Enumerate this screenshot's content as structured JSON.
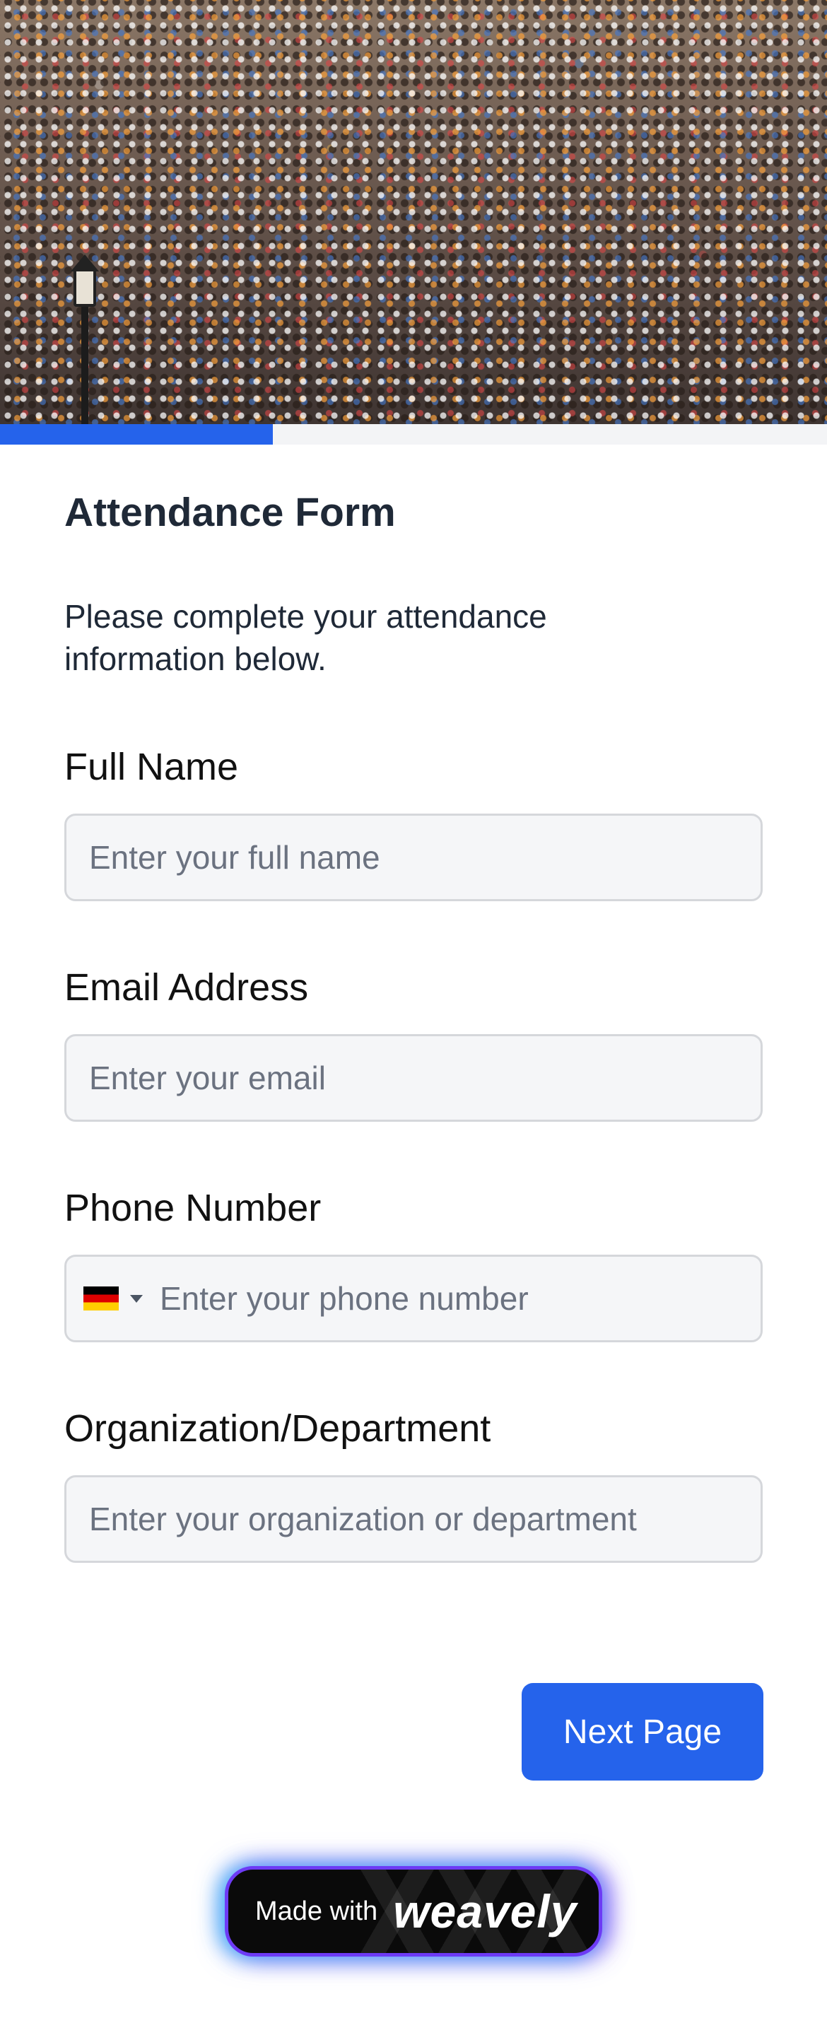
{
  "progress": {
    "fraction": 0.33
  },
  "form": {
    "title": "Attendance Form",
    "description": "Please complete your attendance information below.",
    "fields": {
      "full_name": {
        "label": "Full Name",
        "placeholder": "Enter your full name",
        "value": ""
      },
      "email": {
        "label": "Email Address",
        "placeholder": "Enter your email",
        "value": ""
      },
      "phone": {
        "label": "Phone Number",
        "placeholder": "Enter your phone number",
        "value": "",
        "country_flag": "germany-flag-icon"
      },
      "organization": {
        "label": "Organization/Department",
        "placeholder": "Enter your organization or department",
        "value": ""
      }
    },
    "next_label": "Next Page"
  },
  "badge": {
    "made_with": "Made with",
    "brand": "weavely"
  },
  "colors": {
    "accent": "#2563eb",
    "badge_glow_start": "#38bdf8",
    "badge_glow_end": "#8b5cf6"
  }
}
